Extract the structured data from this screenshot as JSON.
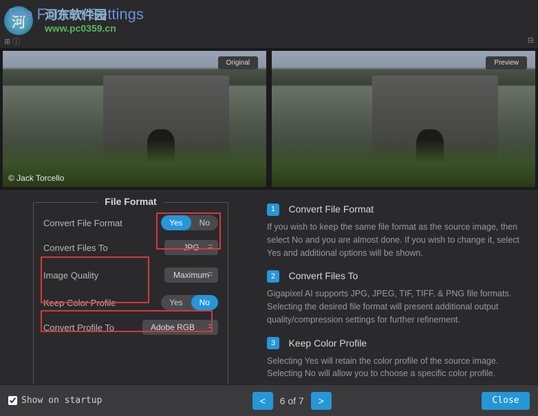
{
  "header": {
    "title": "File Format Settings",
    "watermark_text": "河东软件园",
    "watermark_url": "www.pc0359.cn"
  },
  "previews": {
    "original_label": "Original",
    "preview_label": "Preview",
    "credit": "© Jack Torcello"
  },
  "file_format": {
    "panel_title": "File Format",
    "convert_file_format_label": "Convert File Format",
    "convert_file_format_yes": "Yes",
    "convert_file_format_no": "No",
    "convert_file_format_value": "Yes",
    "convert_files_to_label": "Convert Files To",
    "convert_files_to_value": "JPG",
    "image_quality_label": "Image Quality",
    "image_quality_value": "Maximum",
    "keep_color_profile_label": "Keep Color Profile",
    "keep_color_profile_yes": "Yes",
    "keep_color_profile_no": "No",
    "keep_color_profile_value": "No",
    "convert_profile_to_label": "Convert Profile To",
    "convert_profile_to_value": "Adobe RGB"
  },
  "info": {
    "items": [
      {
        "num": "1",
        "title": "Convert File Format",
        "desc": "If you wish to keep the same file format as the source image, then select No and you are almost done. If you wish to change it, select Yes and additional options will be shown."
      },
      {
        "num": "2",
        "title": "Convert  Files To",
        "desc": "Gigapixel AI supports JPG, JPEG, TIF, TIFF, & PNG  file formats. Selecting the desired file format will present additional output quality/compression settings for further refinement."
      },
      {
        "num": "3",
        "title": "Keep Color Profile",
        "desc": "Selecting Yes will retain the color profile of the source image. Selecting No will allow you to choose a specific color profile."
      }
    ]
  },
  "footer": {
    "show_on_startup_label": "Show on startup",
    "show_on_startup_checked": true,
    "pagination": "6 of 7",
    "close_label": "Close"
  }
}
